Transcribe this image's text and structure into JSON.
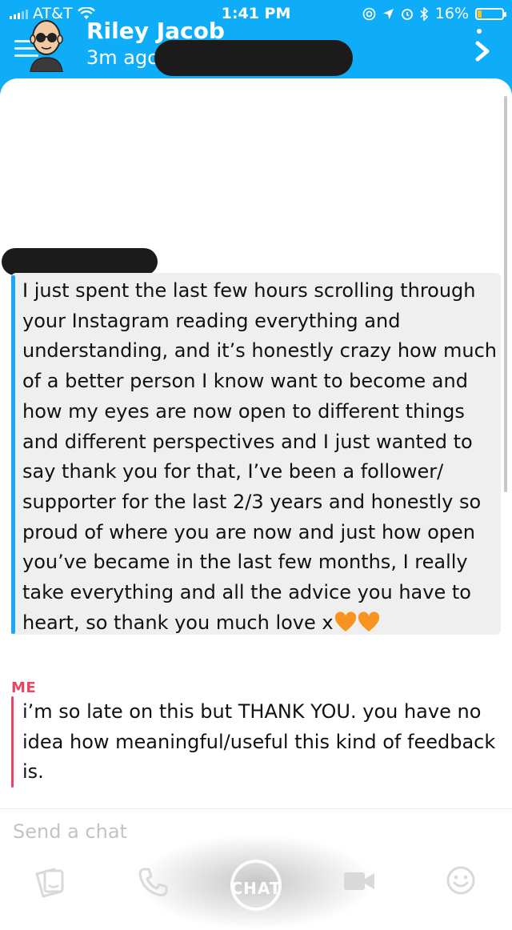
{
  "status_bar": {
    "carrier": "AT&T",
    "time": "1:41 PM",
    "battery": "16%",
    "battery_level": 0.16,
    "icons": [
      "signal-icon",
      "wifi-icon",
      "at-icon",
      "location-arrow-icon",
      "alarm-icon",
      "bluetooth-icon",
      "battery-icon"
    ]
  },
  "header": {
    "contact_name": "Riley Jacob",
    "last_seen": "3m ago",
    "icons": [
      "bitmoji-avatar",
      "menu-icon",
      "more-dots-icon",
      "chevron-right-icon"
    ],
    "background_color": "#0fadf8"
  },
  "messages": [
    {
      "sender": "",
      "text": "I just spent the last few hours scrolling through your Instagram reading everything and understanding, and it’s honestly crazy how much of a better person I know want to become and how my eyes are now open to different things and different perspectives and I just wanted to say thank you for that, I’ve been a follower/ supporter for the last 2/3 years and honestly so proud of where you are now and just how open you’ve became in the last few months, I really take everything and all the advice you have to heart, so thank you much love x",
      "emoji": "orange-heart-icon ×2",
      "accent_color": "#1ca8f3"
    },
    {
      "sender": "ME",
      "text": "i’m so late on this but THANK YOU. you have no idea how meaningful/useful this kind of feedback is.",
      "accent_color": "#e64565"
    }
  ],
  "composer": {
    "placeholder": "Send a chat"
  },
  "bottom_bar": {
    "chat_label": "CHAT",
    "icons": [
      "sticker-icon",
      "phone-icon",
      "chat-button",
      "video-icon",
      "emoji-icon"
    ]
  }
}
